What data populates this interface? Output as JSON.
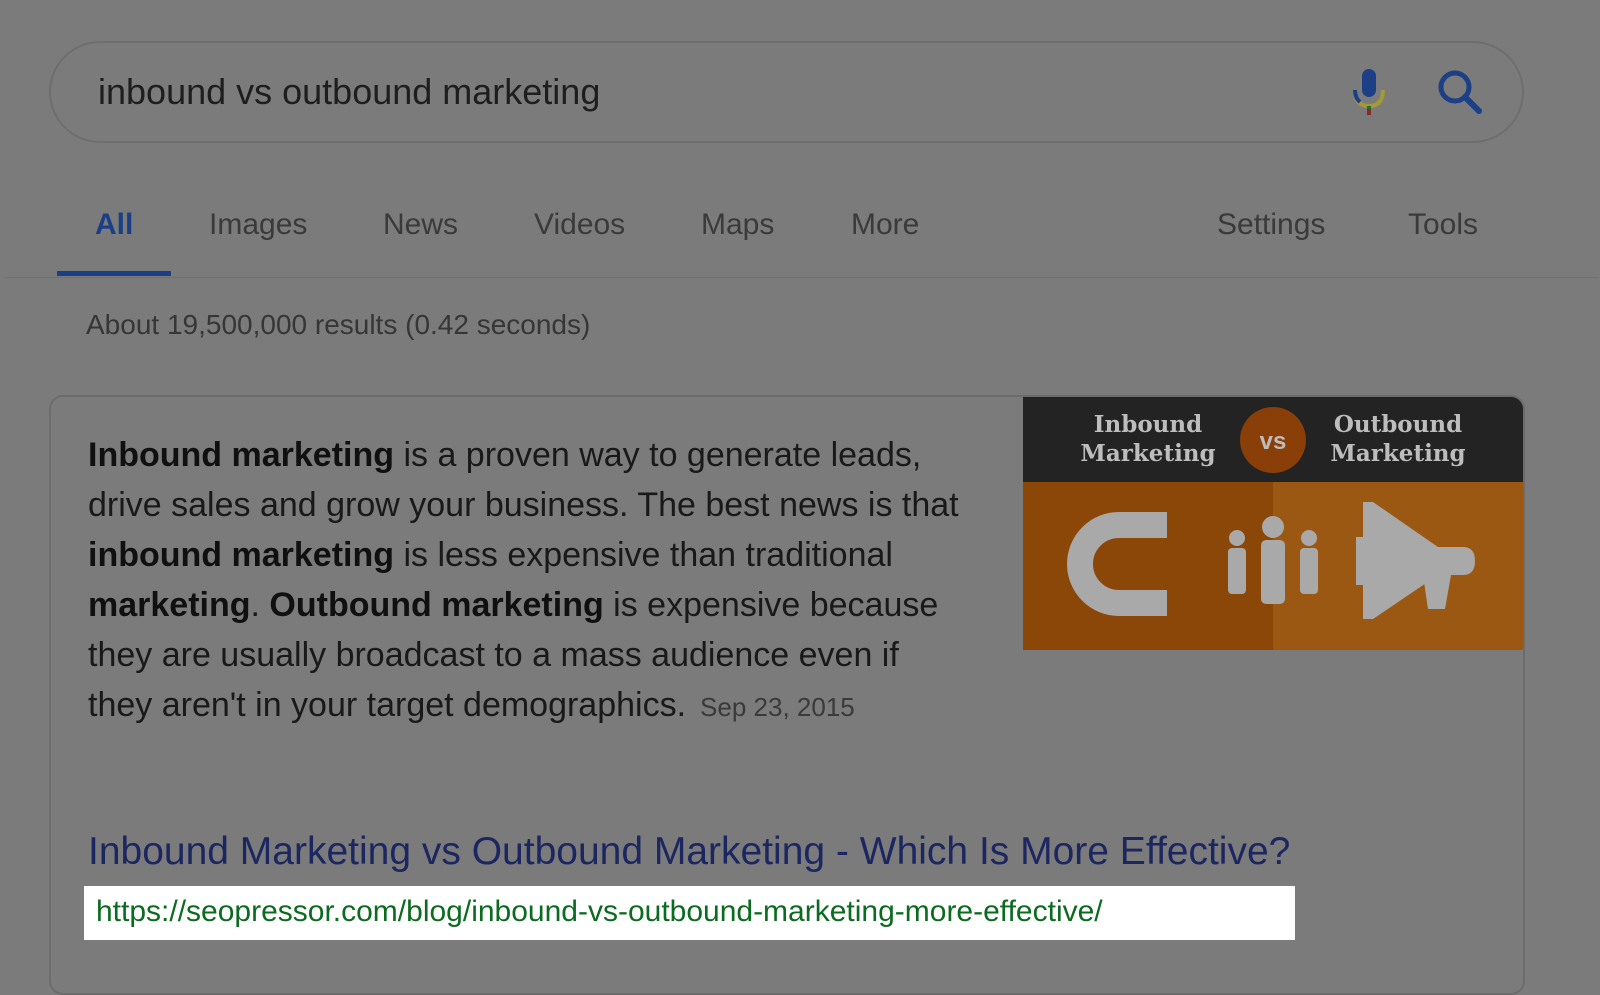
{
  "search": {
    "query": "inbound vs outbound marketing"
  },
  "tabs": {
    "items": [
      {
        "label": "All"
      },
      {
        "label": "Images"
      },
      {
        "label": "News"
      },
      {
        "label": "Videos"
      },
      {
        "label": "Maps"
      },
      {
        "label": "More"
      }
    ],
    "settings": "Settings",
    "tools": "Tools"
  },
  "stats": "About 19,500,000 results (0.42 seconds)",
  "snippet": {
    "parts": [
      {
        "bold": true,
        "text": "Inbound marketing"
      },
      {
        "bold": false,
        "text": " is a proven way to generate leads, drive sales and grow your business. The best news is that "
      },
      {
        "bold": true,
        "text": "inbound marketing"
      },
      {
        "bold": false,
        "text": " is less expensive than traditional "
      },
      {
        "bold": true,
        "text": "marketing"
      },
      {
        "bold": false,
        "text": ". "
      },
      {
        "bold": true,
        "text": "Outbound marketing"
      },
      {
        "bold": false,
        "text": " is expensive because they are usually broadcast to a mass audience even if they aren't in your target demographics."
      }
    ],
    "date": "Sep 23, 2015"
  },
  "thumbnail": {
    "left_line1": "Inbound",
    "left_line2": "Marketing",
    "vs": "vs",
    "right_line1": "Outbound",
    "right_line2": "Marketing"
  },
  "result": {
    "title": "Inbound Marketing vs Outbound Marketing - Which Is More Effective?",
    "url": "https://seopressor.com/blog/inbound-vs-outbound-marketing-more-effective/"
  }
}
